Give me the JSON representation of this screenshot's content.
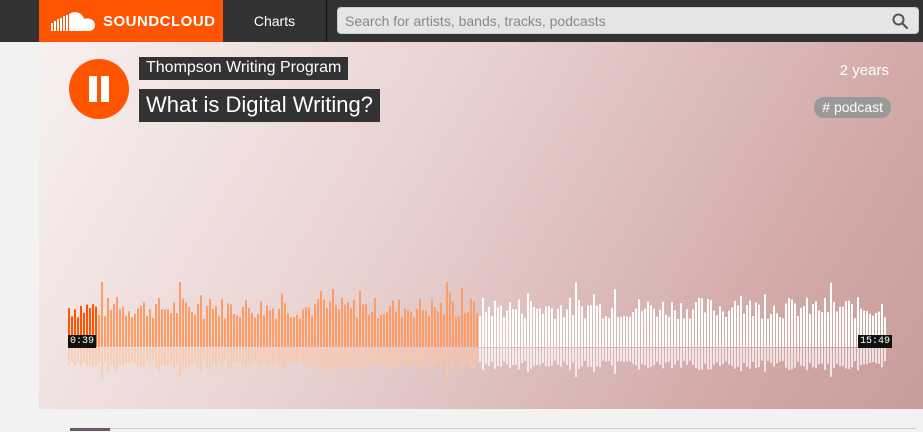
{
  "header": {
    "brand": "SOUNDCLOUD",
    "nav_charts": "Charts",
    "search_placeholder": "Search for artists, bands, tracks, podcasts"
  },
  "track": {
    "artist": "Thompson Writing Program",
    "title": "What is Digital Writing?",
    "age": "2 years",
    "tag": "# podcast",
    "elapsed": "0:39",
    "duration": "15:49",
    "played_fraction": 0.5
  },
  "colors": {
    "brand": "#ff5500",
    "topbar": "#333333",
    "played": "#ff9c66",
    "unplayed": "#ffffff"
  },
  "icons": {
    "logo": "soundcloud-cloud-icon",
    "search": "search-icon",
    "pause": "pause-icon"
  }
}
